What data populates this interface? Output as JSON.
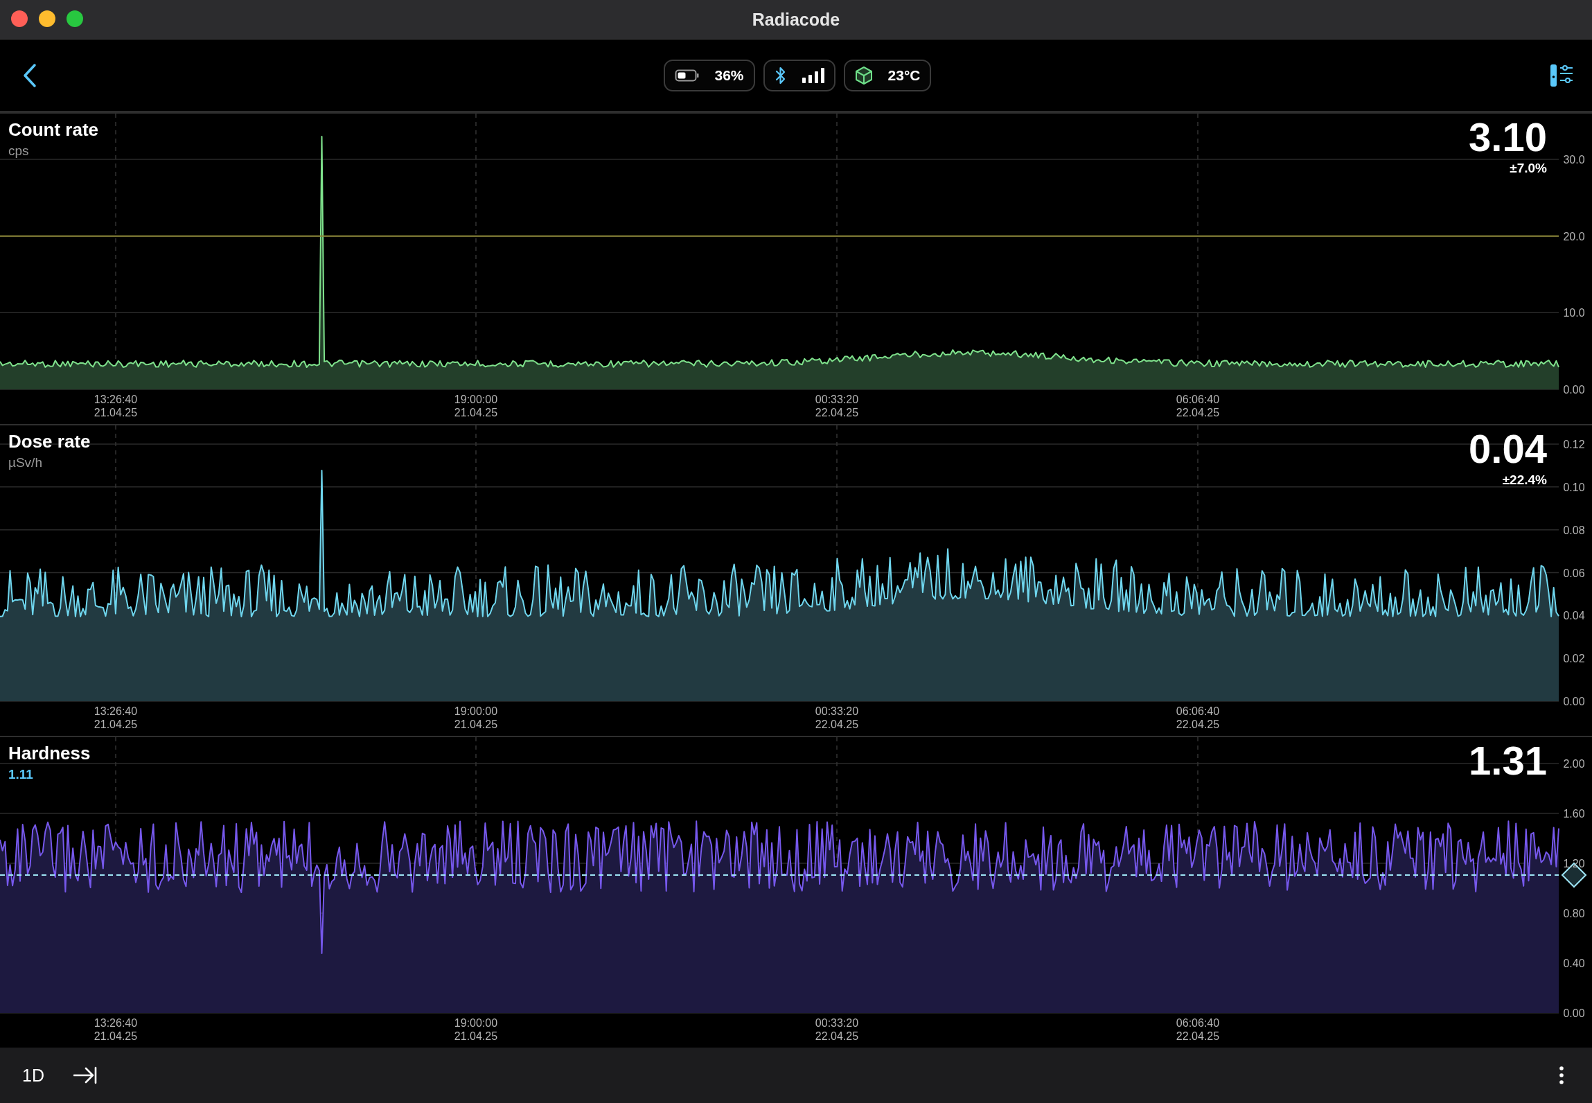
{
  "window": {
    "title": "Radiacode"
  },
  "toolbar": {
    "battery": "36%",
    "temperature": "23°C"
  },
  "panels": [
    {
      "kind": "count",
      "title": "Count rate",
      "unit": "cps",
      "value": "3.10",
      "error": "±7.0%",
      "y_ticks": [
        "30.0",
        "20.0",
        "10.0",
        "0.00"
      ],
      "x_ticks": [
        {
          "time": "13:26:40",
          "date": "21.04.25"
        },
        {
          "time": "19:00:00",
          "date": "21.04.25"
        },
        {
          "time": "00:33:20",
          "date": "22.04.25"
        },
        {
          "time": "06:06:40",
          "date": "22.04.25"
        }
      ]
    },
    {
      "kind": "dose",
      "title": "Dose rate",
      "unit": "µSv/h",
      "value": "0.04",
      "error": "±22.4%",
      "y_ticks": [
        "0.12",
        "0.10",
        "0.08",
        "0.06",
        "0.04",
        "0.02",
        "0.00"
      ],
      "x_ticks": [
        {
          "time": "13:26:40",
          "date": "21.04.25"
        },
        {
          "time": "19:00:00",
          "date": "21.04.25"
        },
        {
          "time": "00:33:20",
          "date": "22.04.25"
        },
        {
          "time": "06:06:40",
          "date": "22.04.25"
        }
      ]
    },
    {
      "kind": "hardness",
      "title": "Hardness",
      "reference": "1.11",
      "value": "1.31",
      "y_ticks": [
        "2.00",
        "1.60",
        "1.20",
        "0.80",
        "0.40",
        "0.00"
      ],
      "x_ticks": [
        {
          "time": "13:26:40",
          "date": "21.04.25"
        },
        {
          "time": "19:00:00",
          "date": "21.04.25"
        },
        {
          "time": "00:33:20",
          "date": "22.04.25"
        },
        {
          "time": "06:06:40",
          "date": "22.04.25"
        }
      ]
    }
  ],
  "bottom_bar": {
    "range": "1D"
  }
}
